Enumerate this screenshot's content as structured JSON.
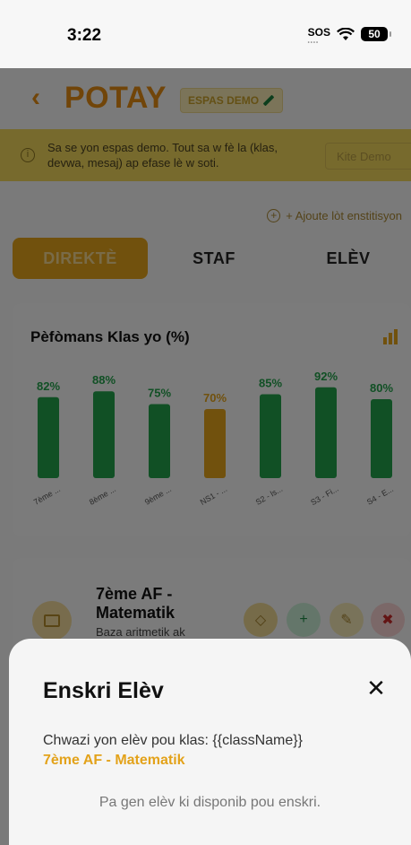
{
  "status": {
    "time": "3:22",
    "sos": "SOS",
    "battery": "50"
  },
  "header": {
    "back_icon": "chevron-left",
    "title": "POTAY",
    "demo_badge": "ESPAS DEMO"
  },
  "banner": {
    "text": "Sa se yon espas demo. Tout sa w fè la (klas, devwa, mesaj) ap efase lè w soti.",
    "quit_label": "Kite Demo"
  },
  "add_institution": "+ Ajoute lòt enstitisyon",
  "tabs": [
    {
      "label": "DIREKTÈ",
      "active": true
    },
    {
      "label": "STAF"
    },
    {
      "label": "ELÈV"
    }
  ],
  "chart_data": {
    "type": "bar",
    "title": "Pèfòmans Klas yo (%)",
    "categories": [
      "7ème ...",
      "8ème ...",
      "9ème ...",
      "NS1 - ...",
      "S2 - ls...",
      "S3 - Fi...",
      "S4 - E..."
    ],
    "values": [
      82,
      88,
      75,
      70,
      85,
      92,
      80
    ],
    "value_labels": [
      "82%",
      "88%",
      "75%",
      "70%",
      "85%",
      "92%",
      "80%"
    ],
    "colors": [
      "#22a04a",
      "#22a04a",
      "#22a04a",
      "#e3a21a",
      "#22a04a",
      "#22a04a",
      "#22a04a"
    ],
    "ylim": [
      0,
      100
    ]
  },
  "class_card": {
    "name": "7ème AF - Matematik",
    "description": "Baza aritmetik ak"
  },
  "sheet": {
    "title": "Enskri Elèv",
    "subtitle": "Chwazi yon elèv pou klas: {{className}}",
    "class_name": "7ème AF - Matematik",
    "empty_message": "Pa gen elèv ki disponib pou enskri."
  }
}
